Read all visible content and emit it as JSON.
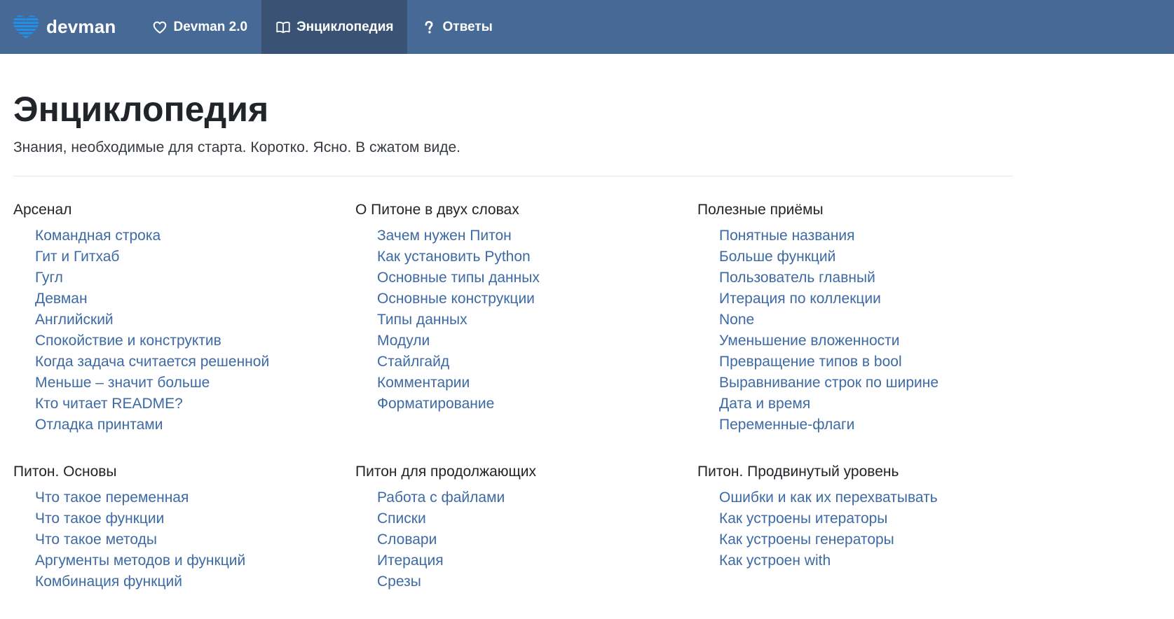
{
  "navbar": {
    "brand": "devman",
    "items": [
      {
        "label": "Devman 2.0",
        "icon": "heart-outline-icon",
        "active": false
      },
      {
        "label": "Энциклопедия",
        "icon": "open-book-icon",
        "active": true
      },
      {
        "label": "Ответы",
        "icon": "question-mark-icon",
        "active": false
      }
    ],
    "colors": {
      "background": "#466996",
      "active_background": "#3a5274",
      "logo": "#1e90e8"
    }
  },
  "page": {
    "title": "Энциклопедия",
    "subtitle": "Знания, необходимые для старта. Коротко. Ясно. В сжатом виде.",
    "link_color": "#3d6aa5"
  },
  "sections": [
    {
      "title": "Арсенал",
      "links": [
        "Командная строка",
        "Гит и Гитхаб",
        "Гугл",
        "Девман",
        "Английский",
        "Спокойствие и конструктив",
        "Когда задача считается решенной",
        "Меньше – значит больше",
        "Кто читает README?",
        "Отладка принтами"
      ]
    },
    {
      "title": "О Питоне в двух словах",
      "links": [
        "Зачем нужен Питон",
        "Как установить Python",
        "Основные типы данных",
        "Основные конструкции",
        "Типы данных",
        "Модули",
        "Стайлгайд",
        "Комментарии",
        "Форматирование"
      ]
    },
    {
      "title": "Полезные приёмы",
      "links": [
        "Понятные названия",
        "Больше функций",
        "Пользователь главный",
        "Итерация по коллекции",
        "None",
        "Уменьшение вложенности",
        "Превращение типов в bool",
        "Выравнивание строк по ширине",
        "Дата и время",
        "Переменные-флаги"
      ]
    },
    {
      "title": "Питон. Основы",
      "links": [
        "Что такое переменная",
        "Что такое функции",
        "Что такое методы",
        "Аргументы методов и функций",
        "Комбинация функций"
      ]
    },
    {
      "title": "Питон для продолжающих",
      "links": [
        "Работа с файлами",
        "Списки",
        "Словари",
        "Итерация",
        "Срезы"
      ]
    },
    {
      "title": "Питон. Продвинутый уровень",
      "links": [
        "Ошибки и как их перехватывать",
        "Как устроены итераторы",
        "Как устроены генераторы",
        "Как устроен with"
      ]
    }
  ]
}
